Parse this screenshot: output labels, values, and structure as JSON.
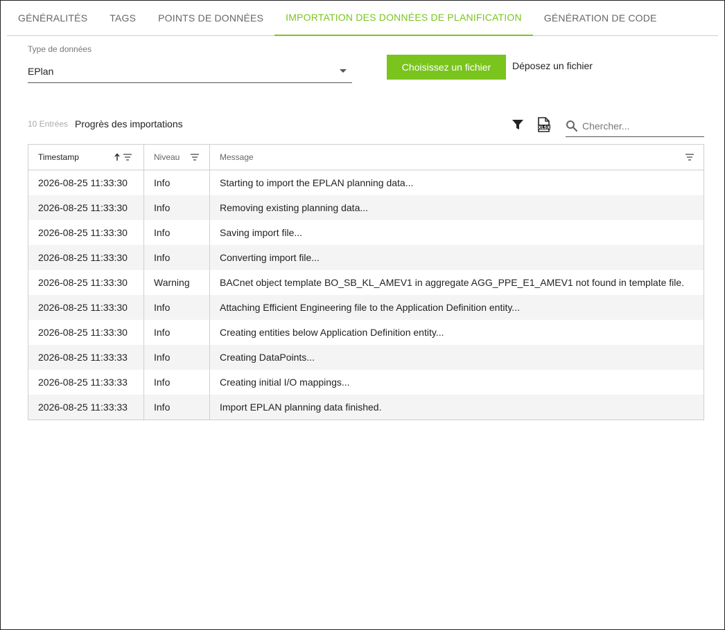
{
  "tabs": [
    {
      "label": "Généralités"
    },
    {
      "label": "Tags"
    },
    {
      "label": "Points de données"
    },
    {
      "label": "Importation des données de planification"
    },
    {
      "label": "Génération de code"
    }
  ],
  "active_tab": 3,
  "data_type": {
    "label": "Type de données",
    "value": "EPlan"
  },
  "file_button_label": "Choisissez un fichier",
  "drop_label": "Déposez un fichier",
  "entries_count": "10 Entrées",
  "progress_title": "Progrès des importations",
  "search": {
    "placeholder": "Chercher..."
  },
  "icons": {
    "filter": "filter-icon",
    "export": "xls-export-icon",
    "search": "search-icon",
    "sort": "sort-ascending-icon",
    "column_filter": "column-filter-icon"
  },
  "accent_color": "#7ac41e",
  "table": {
    "columns": [
      "Timestamp",
      "Niveau",
      "Message"
    ],
    "rows": [
      {
        "timestamp": "2026-08-25 11:33:30",
        "level": "Info",
        "message": "Starting to import the EPLAN planning data..."
      },
      {
        "timestamp": "2026-08-25 11:33:30",
        "level": "Info",
        "message": "Removing existing planning data..."
      },
      {
        "timestamp": "2026-08-25 11:33:30",
        "level": "Info",
        "message": "Saving import file..."
      },
      {
        "timestamp": "2026-08-25 11:33:30",
        "level": "Info",
        "message": "Converting import file..."
      },
      {
        "timestamp": "2026-08-25 11:33:30",
        "level": "Warning",
        "message": "BACnet object template BO_SB_KL_AMEV1 in aggregate AGG_PPE_E1_AMEV1 not found in template file."
      },
      {
        "timestamp": "2026-08-25 11:33:30",
        "level": "Info",
        "message": "Attaching Efficient Engineering file to the Application Definition entity..."
      },
      {
        "timestamp": "2026-08-25 11:33:30",
        "level": "Info",
        "message": "Creating entities below Application Definition entity..."
      },
      {
        "timestamp": "2026-08-25 11:33:33",
        "level": "Info",
        "message": "Creating DataPoints..."
      },
      {
        "timestamp": "2026-08-25 11:33:33",
        "level": "Info",
        "message": "Creating initial I/O mappings..."
      },
      {
        "timestamp": "2026-08-25 11:33:33",
        "level": "Info",
        "message": "Import EPLAN planning data finished."
      }
    ]
  }
}
